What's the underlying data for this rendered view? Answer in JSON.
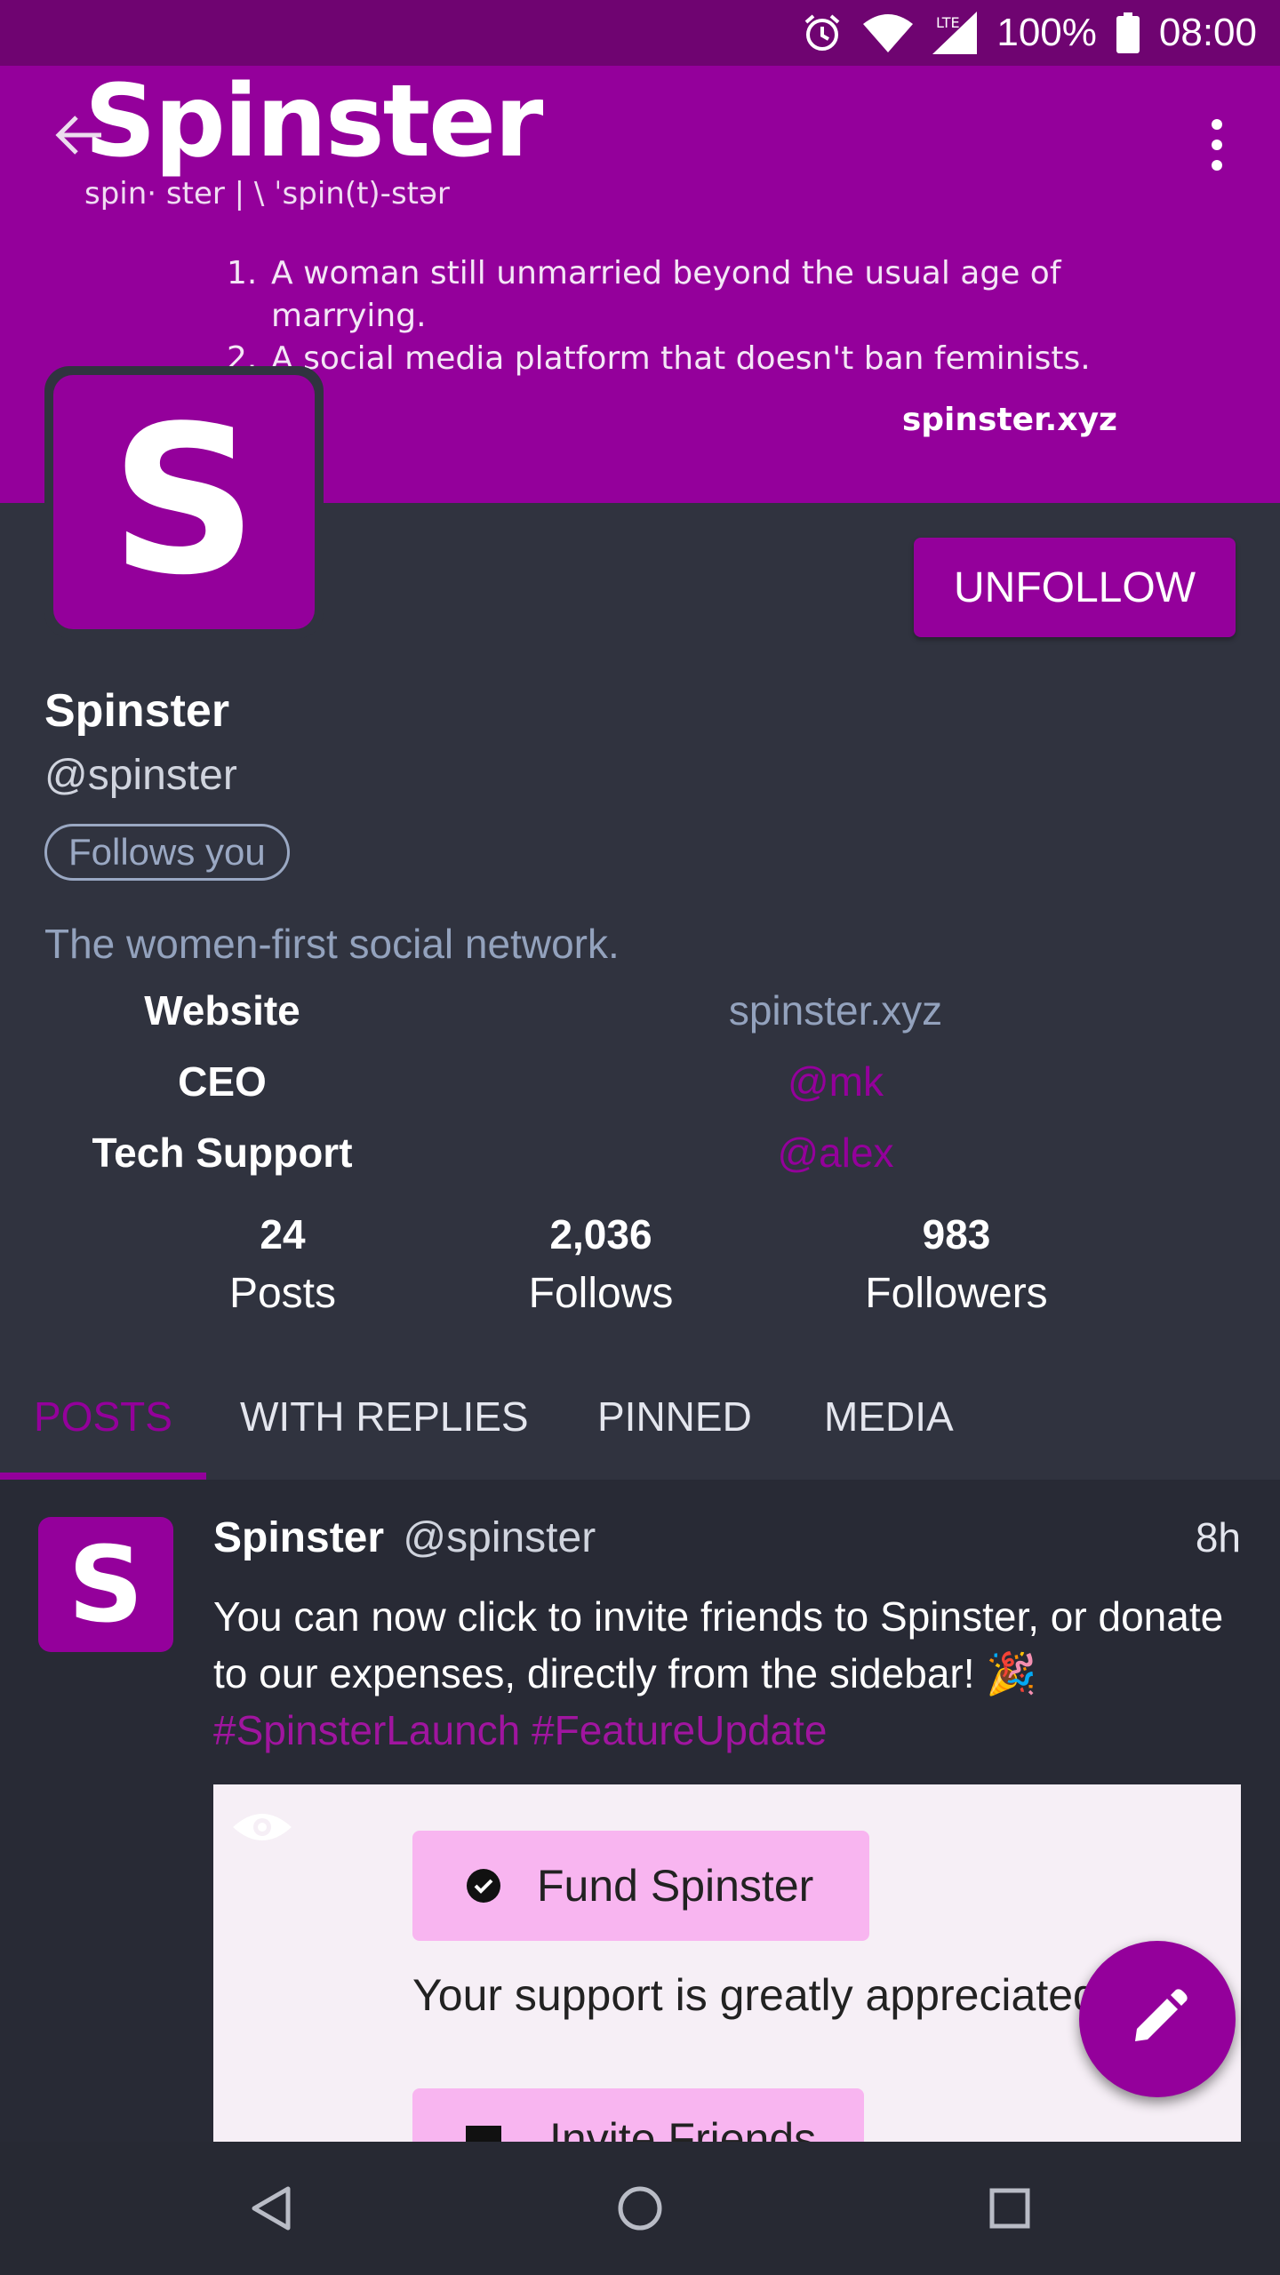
{
  "status_bar": {
    "icons": [
      "alarm-icon",
      "wifi-icon",
      "lte-signal-icon",
      "battery-icon"
    ],
    "network_label": "LTE",
    "battery": "100%",
    "time": "08:00"
  },
  "header": {
    "brand": "Spinster",
    "pronunciation": "spin· ster | \\ ˈspin(t)-stər",
    "definitions": [
      {
        "num": "1.",
        "text": "A woman still unmarried beyond the usual age of marrying."
      },
      {
        "num": "2.",
        "text": "A social media platform that doesn't ban feminists."
      }
    ],
    "banner_url": "spinster.xyz",
    "accent_color": "#94009b"
  },
  "profile": {
    "avatar_letter": "S",
    "display_name": "Spinster",
    "handle": "@spinster",
    "follows_you": "Follows you",
    "bio": "The women-first social network.",
    "unfollow_label": "UNFOLLOW",
    "fields": [
      {
        "label": "Website",
        "value": "spinster.xyz",
        "color": "#93a2bd"
      },
      {
        "label": "CEO",
        "value": "@mk",
        "color": "#94009b"
      },
      {
        "label": "Tech Support",
        "value": "@alex",
        "color": "#94009b"
      }
    ],
    "stats": [
      {
        "num": "24",
        "label": "Posts"
      },
      {
        "num": "2,036",
        "label": "Follows"
      },
      {
        "num": "983",
        "label": "Followers"
      }
    ]
  },
  "tabs": [
    {
      "label": "POSTS",
      "active": true
    },
    {
      "label": "WITH REPLIES",
      "active": false
    },
    {
      "label": "PINNED",
      "active": false
    },
    {
      "label": "MEDIA",
      "active": false
    }
  ],
  "post": {
    "avatar_letter": "S",
    "name": "Spinster",
    "handle": "@spinster",
    "time": "8h",
    "text": "You can now click to invite friends to Spinster, or donate to our expenses, directly from the sidebar!",
    "emoji": "🎉",
    "hashtags": "#SpinsterLaunch #FeatureUpdate",
    "media": {
      "button1": "Fund Spinster",
      "support_text": "Your support is greatly appreciated",
      "button2": "Invite Friends"
    }
  },
  "fab": {
    "icon": "pencil-icon"
  },
  "nav": {
    "icons": [
      "back-nav-icon",
      "home-nav-icon",
      "recents-nav-icon"
    ]
  }
}
